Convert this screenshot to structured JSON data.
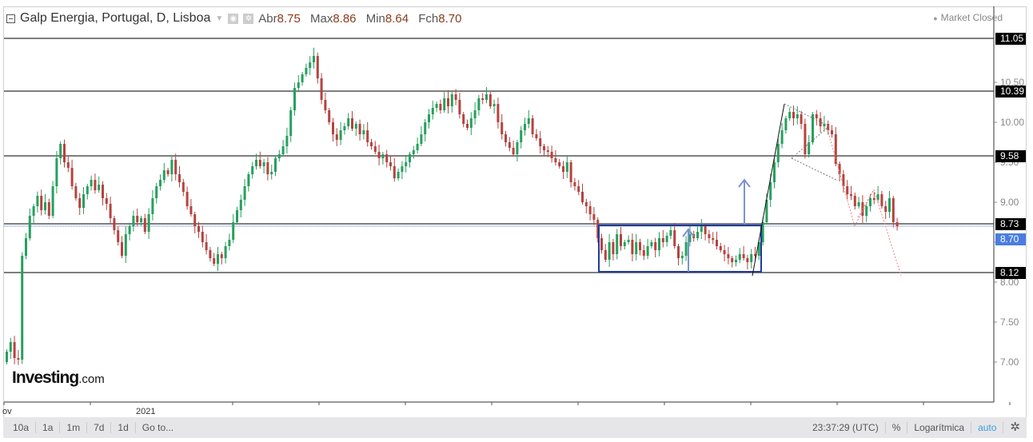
{
  "header": {
    "title": "Galp Energia, Portugal, D, Lisboa",
    "ohlc": [
      {
        "label": "Abr",
        "value": "8.75"
      },
      {
        "label": "Max",
        "value": "8.86"
      },
      {
        "label": "Min",
        "value": "8.64"
      },
      {
        "label": "Fch",
        "value": "8.70"
      }
    ],
    "status": "Market Closed"
  },
  "logo": {
    "main": "Investing",
    "suffix": ".com"
  },
  "footer": {
    "ranges": [
      "10a",
      "1a",
      "1m",
      "7d",
      "1d"
    ],
    "goto": "Go to...",
    "time": "23:37:29 (UTC)",
    "percent": "%",
    "log": "Logarítmica",
    "auto": "auto"
  },
  "colors": {
    "up": "#26a05e",
    "down": "#b5433f",
    "levels": "#555555",
    "box": "#1f3a9c",
    "arrow": "#7b93d0",
    "last": "#4a7de0"
  },
  "chart_data": {
    "type": "candlestick",
    "xlabels": [
      "ov",
      "2021"
    ],
    "ylim": [
      6.6,
      11.45
    ],
    "yticks": [
      "10.50",
      "10.00",
      "9.50",
      "9.00",
      "8.50",
      "8.00",
      "7.50",
      "7.00"
    ],
    "levels": [
      "11.05",
      "10.39",
      "9.58",
      "8.73",
      "8.12"
    ],
    "last_price": "8.70",
    "closes": [
      7.13,
      7.25,
      7.05,
      7.03,
      8.33,
      8.55,
      8.83,
      8.95,
      9.08,
      8.9,
      9.0,
      8.83,
      9.2,
      9.55,
      9.73,
      9.5,
      9.43,
      9.2,
      9.05,
      8.93,
      9.1,
      9.2,
      9.28,
      9.15,
      9.22,
      9.05,
      8.98,
      8.8,
      8.65,
      8.5,
      8.33,
      8.6,
      8.7,
      8.83,
      8.75,
      8.8,
      8.63,
      8.85,
      9.05,
      9.2,
      9.28,
      9.4,
      9.35,
      9.53,
      9.35,
      9.25,
      9.13,
      8.95,
      8.85,
      8.7,
      8.63,
      8.5,
      8.4,
      8.3,
      8.23,
      8.35,
      8.3,
      8.45,
      8.53,
      8.75,
      8.9,
      9.03,
      9.2,
      9.35,
      9.45,
      9.53,
      9.45,
      9.5,
      9.35,
      9.38,
      9.55,
      9.6,
      9.7,
      9.83,
      10.15,
      10.43,
      10.5,
      10.6,
      10.68,
      10.75,
      10.83,
      10.55,
      10.28,
      10.15,
      10.0,
      9.85,
      9.78,
      9.9,
      9.95,
      10.05,
      9.92,
      9.98,
      9.85,
      9.9,
      9.75,
      9.7,
      9.63,
      9.55,
      9.6,
      9.5,
      9.45,
      9.3,
      9.38,
      9.45,
      9.5,
      9.6,
      9.65,
      9.73,
      9.85,
      10.0,
      10.1,
      10.18,
      10.23,
      10.15,
      10.3,
      10.2,
      10.35,
      10.28,
      10.1,
      9.98,
      9.93,
      10.05,
      10.15,
      10.3,
      10.28,
      10.35,
      10.2,
      10.23,
      10.0,
      9.85,
      9.75,
      9.68,
      9.6,
      9.75,
      9.9,
      9.98,
      10.05,
      9.85,
      9.8,
      9.7,
      9.65,
      9.63,
      9.55,
      9.5,
      9.45,
      9.38,
      9.5,
      9.25,
      9.2,
      9.13,
      9.0,
      8.95,
      8.85,
      8.78,
      8.55,
      8.4,
      8.28,
      8.5,
      8.35,
      8.6,
      8.45,
      8.5,
      8.53,
      8.35,
      8.5,
      8.4,
      8.33,
      8.45,
      8.5,
      8.4,
      8.55,
      8.5,
      8.58,
      8.65,
      8.45,
      8.3,
      8.33,
      8.5,
      8.6,
      8.55,
      8.63,
      8.7,
      8.6,
      8.55,
      8.53,
      8.45,
      8.4,
      8.35,
      8.3,
      8.25,
      8.28,
      8.35,
      8.3,
      8.25,
      8.35,
      8.33,
      8.5,
      8.75,
      9.03,
      9.25,
      9.5,
      9.73,
      9.9,
      10.05,
      10.13,
      10.05,
      10.1,
      9.98,
      9.6,
      9.75,
      10.1,
      10.05,
      9.95,
      9.98,
      9.9,
      9.85,
      9.48,
      9.35,
      9.2,
      9.1,
      9.08,
      8.95,
      9.0,
      8.83,
      8.95,
      9.05,
      9.03,
      9.1,
      8.95,
      8.88,
      9.05,
      8.75,
      8.7
    ]
  }
}
